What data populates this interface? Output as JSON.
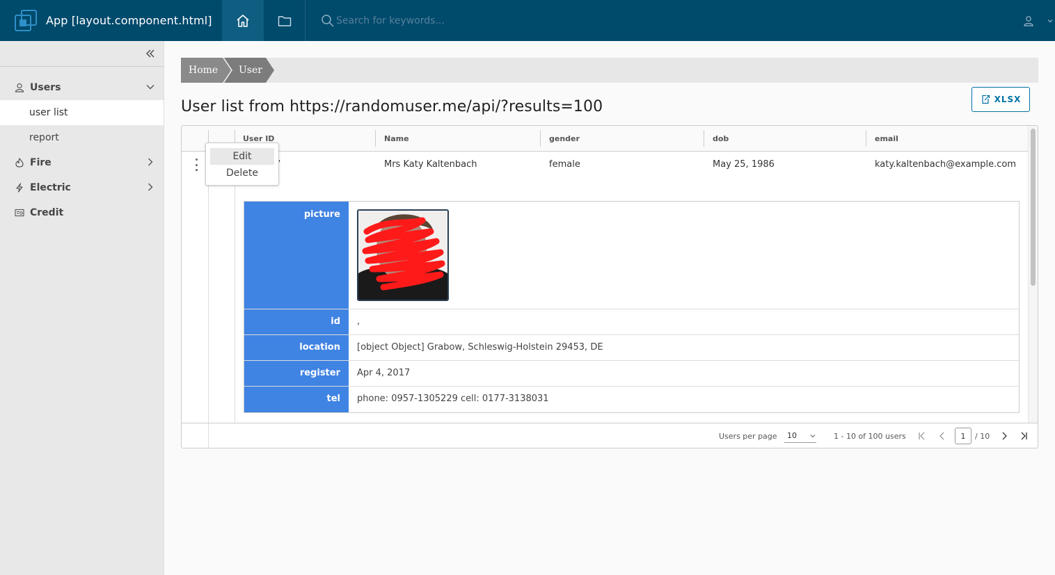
{
  "header": {
    "app_title": "App [layout.component.html]",
    "search_placeholder": "Search for keywords..."
  },
  "sidebar": {
    "groups": [
      {
        "label": "Users",
        "icon": "user-icon",
        "expanded": true
      },
      {
        "label": "Fire",
        "icon": "fire-icon",
        "expanded": false
      },
      {
        "label": "Electric",
        "icon": "bolt-icon",
        "expanded": false
      },
      {
        "label": "Credit",
        "icon": "credit-icon"
      }
    ],
    "users_items": [
      {
        "label": "user list",
        "active": true
      },
      {
        "label": "report",
        "active": false
      }
    ]
  },
  "breadcrumb": [
    "Home",
    "User"
  ],
  "page_title": "User list from https://randomuser.me/api/?results=100",
  "export_button": "XLSX",
  "grid": {
    "columns": [
      "User ID",
      "Name",
      "gender",
      "dob",
      "email"
    ],
    "rows": [
      {
        "user_id": "ebra237",
        "name": "Mrs Katy Kaltenbach",
        "gender": "female",
        "dob": "May 25, 1986",
        "email": "katy.kaltenbach@example.com"
      }
    ],
    "detail": {
      "picture_label": "picture",
      "id_label": "id",
      "id_value": ",",
      "location_label": "location",
      "location_value": "[object Object] Grabow, Schleswig-Holstein 29453, DE",
      "register_label": "register",
      "register_value": "Apr 4, 2017",
      "tel_label": "tel",
      "tel_value": "phone: 0957-1305229 cell: 0177-3138031"
    },
    "footer": {
      "per_page_label": "Users per page",
      "per_page_value": "10",
      "range_text": "1 - 10 of 100 users",
      "current_page": "1",
      "total_pages": "/ 10"
    }
  },
  "context_menu": [
    "Edit",
    "Delete"
  ],
  "colors": {
    "header_bg": "#004a6c",
    "detail_label_bg": "#3f83e3",
    "accent": "#0072a3"
  }
}
